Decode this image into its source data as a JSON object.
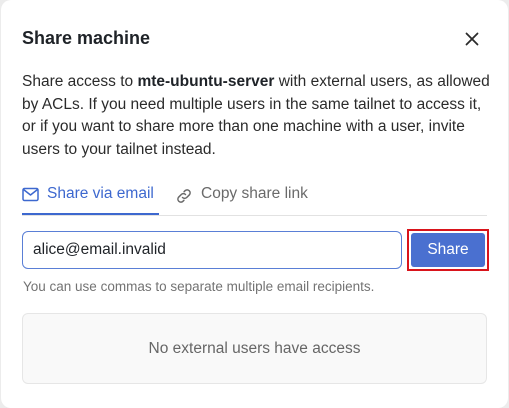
{
  "dialog": {
    "title": "Share machine",
    "close_icon": "close-icon"
  },
  "description": {
    "prefix": "Share access to ",
    "machine_name": "mte-ubuntu-server",
    "suffix": " with external users, as allowed by ACLs. If you need multiple users in the same tailnet to access it, or if you want to share more than one machine with a user, invite users to your tailnet instead."
  },
  "tabs": [
    {
      "label": "Share via email",
      "icon": "mail-icon",
      "active": true
    },
    {
      "label": "Copy share link",
      "icon": "link-icon",
      "active": false
    }
  ],
  "email_input": {
    "value": "alice@email.invalid"
  },
  "share_button": {
    "label": "Share"
  },
  "hint": "You can use commas to separate multiple email recipients.",
  "empty_state": "No external users have access",
  "colors": {
    "accent": "#3d68cf",
    "button": "#4a70d0",
    "highlight_border": "#d9141b"
  }
}
